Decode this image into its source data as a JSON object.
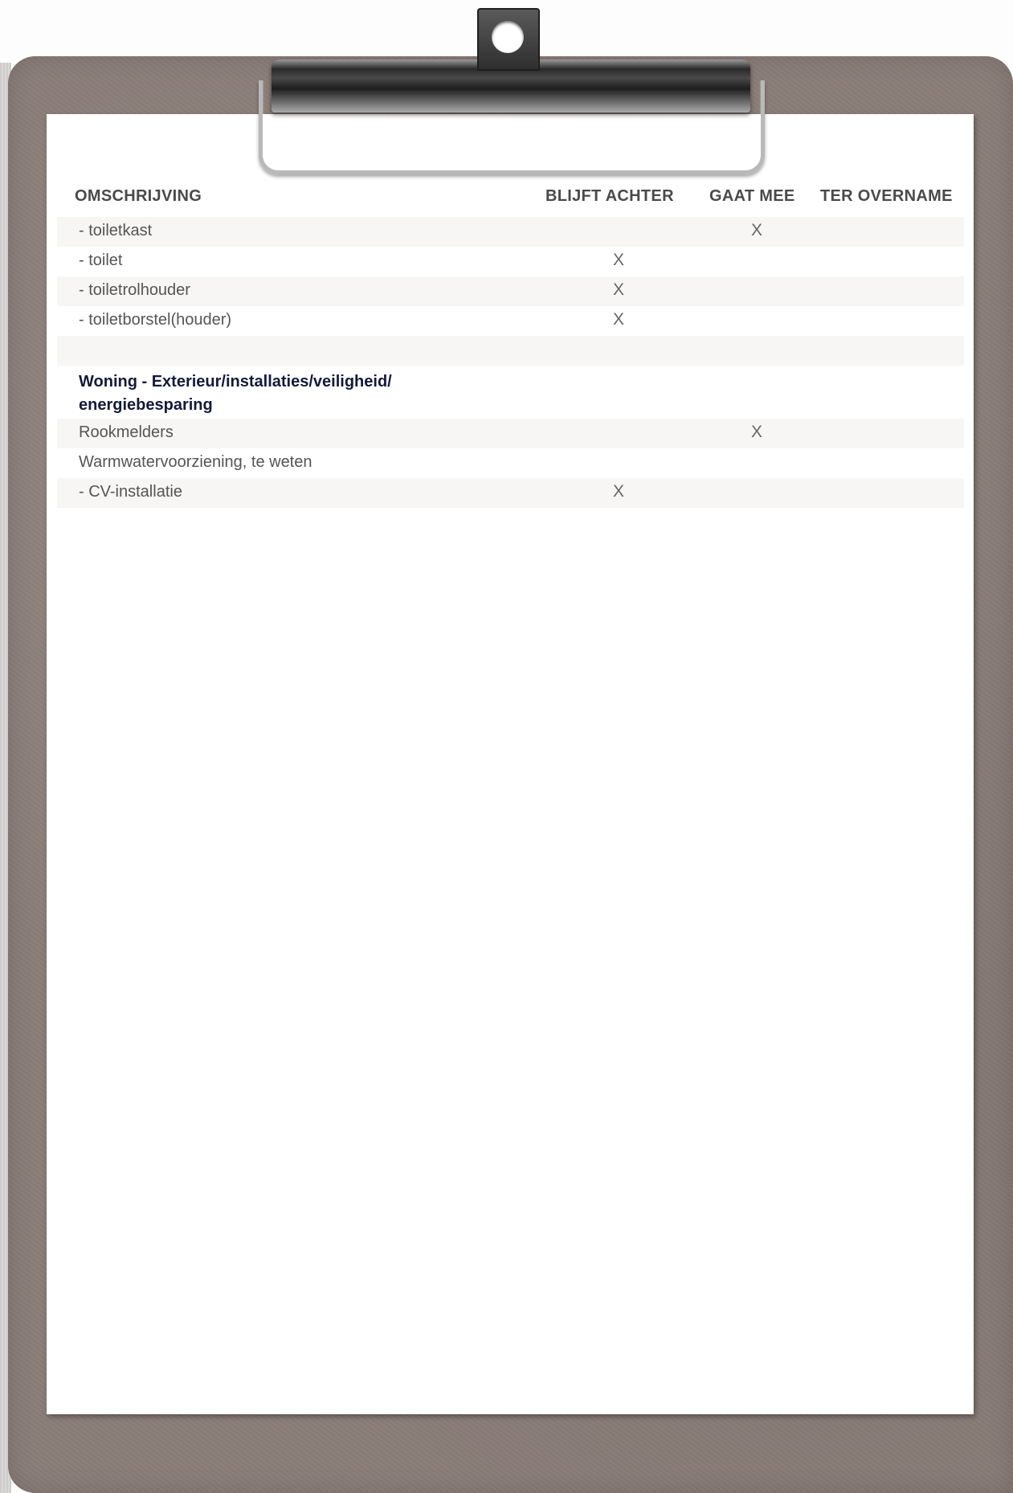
{
  "table": {
    "headers": {
      "description": "OMSCHRIJVING",
      "stays": "BLIJFT ACHTER",
      "goes": "GAAT MEE",
      "takeover": "TER OVERNAME"
    },
    "rows": [
      {
        "label": " - toiletkast",
        "stays": "",
        "goes": "X",
        "takeover": ""
      },
      {
        "label": " - toilet",
        "stays": "X",
        "goes": "",
        "takeover": ""
      },
      {
        "label": " - toiletrolhouder",
        "stays": "X",
        "goes": "",
        "takeover": ""
      },
      {
        "label": " - toiletborstel(houder)",
        "stays": "X",
        "goes": "",
        "takeover": ""
      },
      {
        "label": "",
        "stays": "",
        "goes": "",
        "takeover": ""
      }
    ],
    "section_title": "Woning - Exterieur/installaties/veiligheid/ energiebesparing",
    "section_rows": [
      {
        "label": "Rookmelders",
        "stays": "",
        "goes": "X",
        "takeover": ""
      },
      {
        "label": "Warmwatervoorziening, te weten",
        "stays": "",
        "goes": "",
        "takeover": ""
      },
      {
        "label": " - CV-installatie",
        "stays": "X",
        "goes": "",
        "takeover": ""
      }
    ]
  },
  "colors": {
    "board": "#8a7d78",
    "row_shade": "#f7f6f4",
    "section_text": "#141a3a"
  }
}
